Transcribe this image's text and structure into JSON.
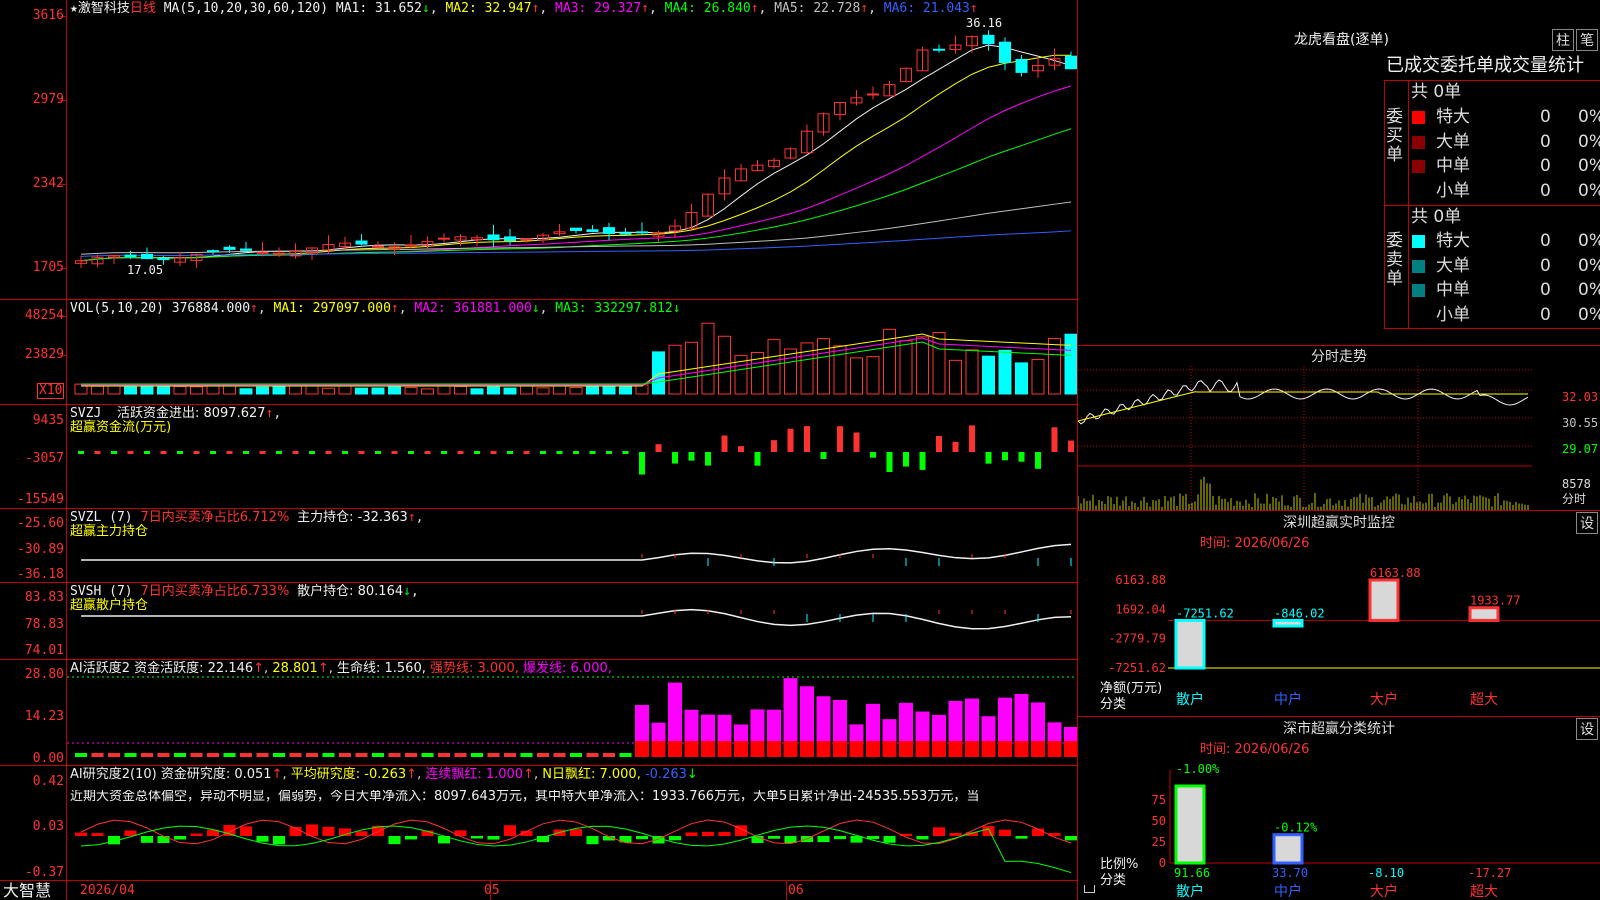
{
  "app": {
    "brand": "大智慧",
    "star": "★",
    "stock_name": "激智科技",
    "period": "日线"
  },
  "dates": {
    "d1": "2026/04",
    "d2": "05",
    "d3": "06"
  },
  "main": {
    "ma_label": "MA(5,10,20,30,60,120)",
    "ma": [
      {
        "t": "MA1: 31.652",
        "arrow": "↓",
        "color": "#f0f0f0"
      },
      {
        "t": "MA2: 32.947",
        "arrow": "↑",
        "color": "#ffff00"
      },
      {
        "t": "MA3: 29.327",
        "arrow": "↑",
        "color": "#ff00ff"
      },
      {
        "t": "MA4: 26.840",
        "arrow": "↑",
        "color": "#00ff00"
      },
      {
        "t": "MA5: 22.728",
        "arrow": "↑",
        "color": "#c0c0c0"
      },
      {
        "t": "MA6: 21.043",
        "arrow": "↑",
        "color": "#3060ff"
      }
    ],
    "y": [
      "3616",
      "2979",
      "2342",
      "1705"
    ],
    "hi": "36.16",
    "lo": "17.05"
  },
  "vol": {
    "label": "VOL(5,10,20)",
    "v": "376884.000",
    "ma1": "MA1: 297097.000",
    "ma2": "MA2: 361881.000",
    "ma3": "MA3: 332297.812",
    "y": [
      "48254",
      "23829"
    ],
    "unit": "X10"
  },
  "svzj": {
    "label": "SVZJ",
    "desc": "活跃资金进出: 8097.627",
    "sub": "超赢资金流(万元)",
    "y": [
      "9435",
      "-3057",
      "-15549"
    ]
  },
  "svzl": {
    "label": "SVZL (7)",
    "txt1": "7日内买卖净占比6.712%",
    "txt2": "主力持仓: -32.363",
    "sub": "超赢主力持仓",
    "y": [
      "-25.60",
      "-30.89",
      "-36.18"
    ]
  },
  "svsh": {
    "label": "SVSH (7)",
    "txt1": "7日内买卖净占比6.733%",
    "txt2": "散户持仓: 80.164",
    "sub": "超赢散户持仓",
    "y": [
      "83.83",
      "78.83",
      "74.01"
    ]
  },
  "ai1": {
    "label": "AI活跃度2",
    "t1": "资金活跃度: 22.146",
    "t2": "28.801",
    "t3": "生命线: 1.560,",
    "t4": "强势线: 3.000,",
    "t5": "爆发线: 6.000,",
    "y": [
      "28.80",
      "14.23",
      "0.00"
    ]
  },
  "ai2": {
    "label": "AI研究度2(10)",
    "t1": "资金研究度: 0.051",
    "t2": "平均研究度: -0.263",
    "t3": "连续飘红: 1.000",
    "t4": "N日飘红: 7.000,",
    "t5": "-0.263",
    "comment": "近期大资金总体偏空，异动不明显，偏弱势，今日大单净流入：8097.643万元，其中特大单净流入：1933.766万元，大单5日累计净出-24535.553万元，当",
    "y": [
      "0.42",
      "0.03",
      "-0.37"
    ]
  },
  "lhb": {
    "title": "龙虎看盘(逐单)",
    "btn1": "柱",
    "btn2": "笔",
    "head": "已成交委托单成交量统计",
    "buy": {
      "side": "委买单",
      "total": "共 0单",
      "rows": [
        {
          "n": "特大",
          "v": "0",
          "p": "0%",
          "c": "#ff0000"
        },
        {
          "n": "大单",
          "v": "0",
          "p": "0%",
          "c": "#8b0000"
        },
        {
          "n": "中单",
          "v": "0",
          "p": "0%",
          "c": "#8b0000"
        },
        {
          "n": "小单",
          "v": "0",
          "p": "0%",
          "c": ""
        }
      ]
    },
    "sell": {
      "side": "委卖单",
      "total": "共 0单",
      "rows": [
        {
          "n": "特大",
          "v": "0",
          "p": "0%",
          "c": "#00ffff"
        },
        {
          "n": "大单",
          "v": "0",
          "p": "0%",
          "c": "#008080"
        },
        {
          "n": "中单",
          "v": "0",
          "p": "0%",
          "c": "#008080"
        },
        {
          "n": "小单",
          "v": "0",
          "p": "0%",
          "c": ""
        }
      ]
    }
  },
  "fenshi": {
    "title": "分时走势",
    "y": [
      "32.03",
      "30.55",
      "29.07"
    ],
    "vol": "8578",
    "vol_unit": "分时"
  },
  "sz_monitor": {
    "title": "深圳超赢实时监控",
    "btn": "设",
    "time": "时间: 2026/06/26",
    "y": [
      "6163.88",
      "1692.04",
      "-2779.79",
      "-7251.62"
    ],
    "yunit": "净额(万元)",
    "xunit": "分类",
    "cats": [
      "散户",
      "中户",
      "大户",
      "超大"
    ],
    "vals": [
      {
        "t": "-7251.62",
        "v": -7251.62,
        "c": "#00ffff"
      },
      {
        "t": "-846.02",
        "v": -846.02,
        "c": "#00ffff"
      },
      {
        "t": "6163.88",
        "v": 6163.88,
        "c": "#ff3232"
      },
      {
        "t": "1933.77",
        "v": 1933.77,
        "c": "#ff3232"
      }
    ]
  },
  "sz_class": {
    "title": "深市超赢分类统计",
    "btn": "设",
    "time": "时间: 2026/06/26",
    "y": [
      "75",
      "50",
      "25",
      "0"
    ],
    "yunit": "比例%",
    "xunit": "分类",
    "cats": [
      "散户",
      "中户",
      "大户",
      "超大"
    ],
    "tops": [
      "-1.00%",
      "-0.12%"
    ],
    "vals": [
      {
        "t": "91.66",
        "v": 91.66,
        "c": "#00ff00"
      },
      {
        "t": "33.70",
        "v": 33.7,
        "c": "#3060ff"
      },
      {
        "t": "-8.10",
        "v": -8.1,
        "c": "#00ffff"
      },
      {
        "t": "-17.27",
        "v": -17.27,
        "c": "#ff3232"
      }
    ]
  }
}
